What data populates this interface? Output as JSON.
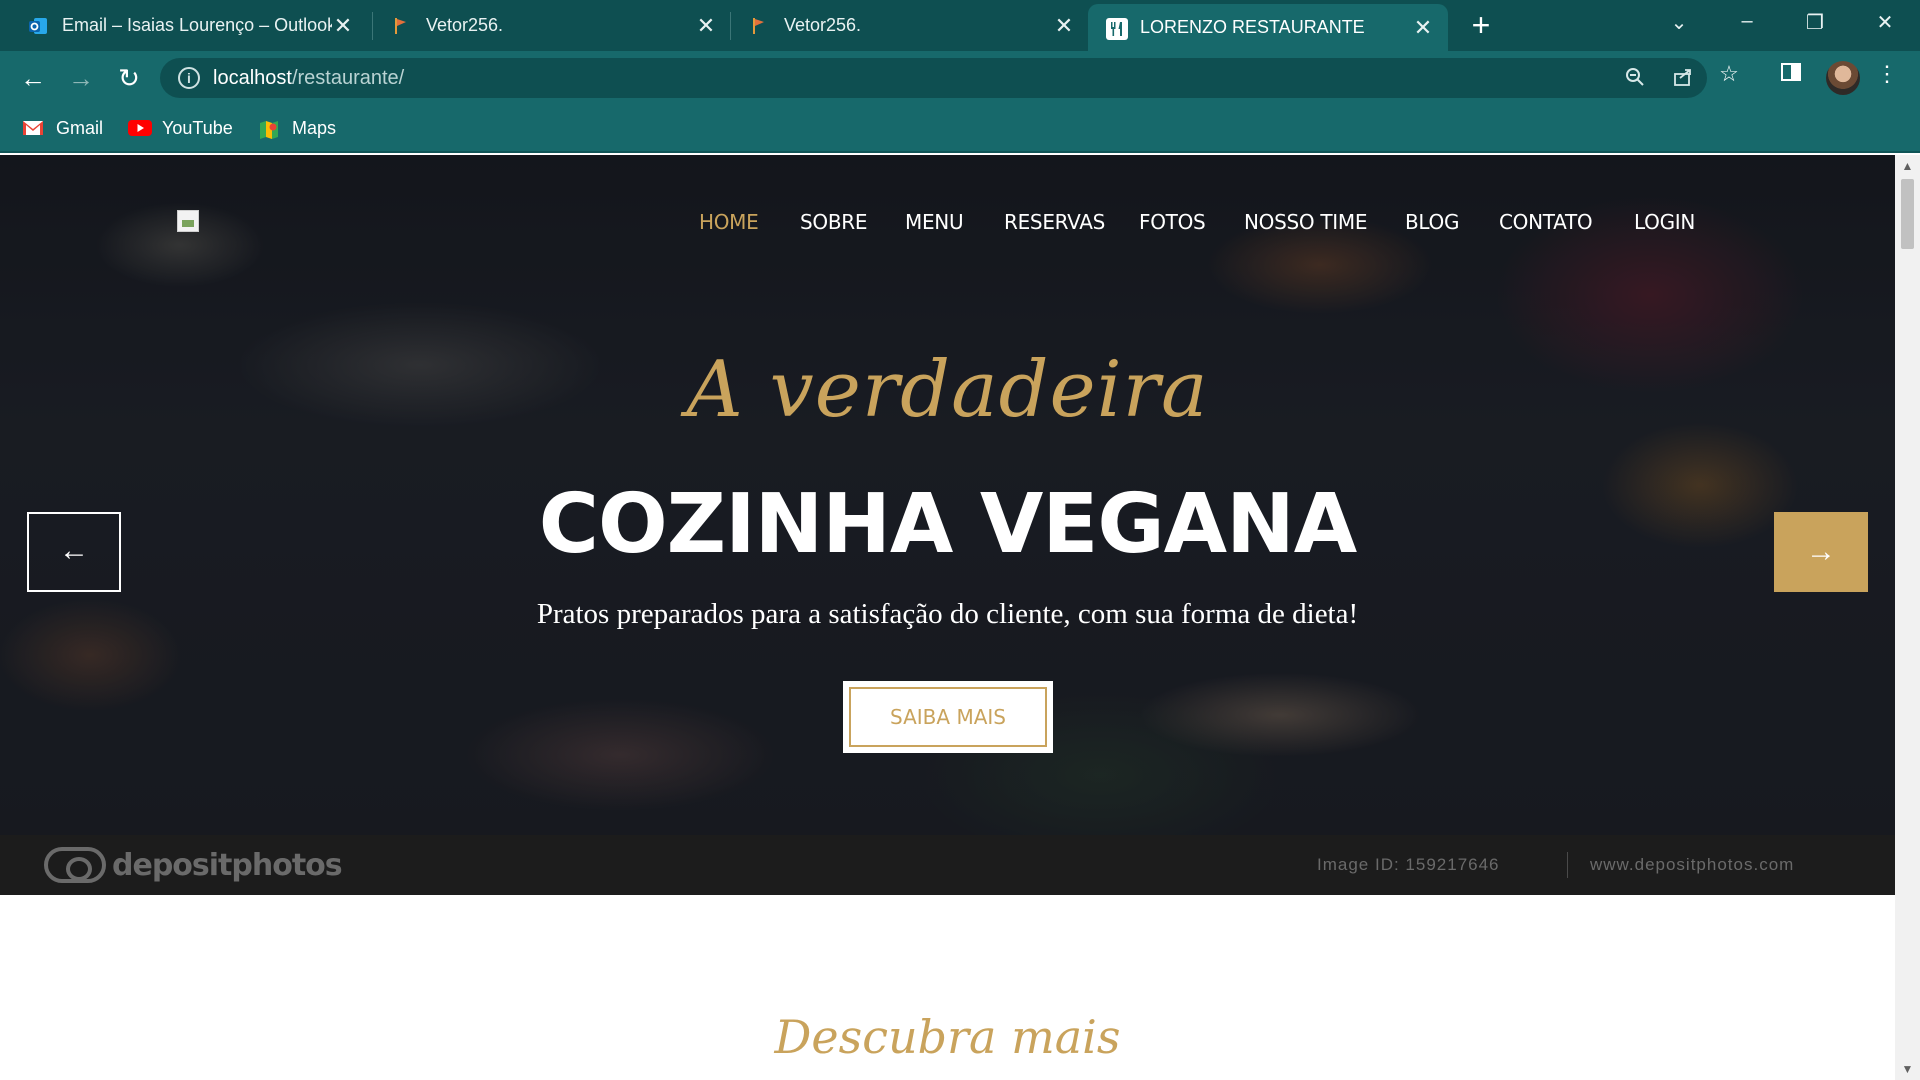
{
  "browser": {
    "tabs": [
      {
        "title": "Email – Isaias Lourenço – Outlook",
        "icon": "outlook-icon",
        "active": false
      },
      {
        "title": "Vetor256.",
        "icon": "flag-icon",
        "active": false
      },
      {
        "title": "Vetor256.",
        "icon": "flag-icon",
        "active": false
      },
      {
        "title": "LORENZO RESTAURANTE",
        "icon": "fork-knife-icon",
        "active": true
      }
    ],
    "new_tab_label": "+",
    "url_host": "localhost",
    "url_path": "/restaurante/",
    "bookmarks": [
      {
        "label": "Gmail",
        "icon": "gmail-icon"
      },
      {
        "label": "YouTube",
        "icon": "youtube-icon"
      },
      {
        "label": "Maps",
        "icon": "maps-icon"
      }
    ],
    "colors": {
      "chrome_dark": "#0e4f51",
      "chrome": "#17696b"
    }
  },
  "site": {
    "nav": [
      {
        "label": "HOME",
        "active": true
      },
      {
        "label": "SOBRE",
        "active": false
      },
      {
        "label": "MENU",
        "active": false
      },
      {
        "label": "RESERVAS",
        "active": false
      },
      {
        "label": "FOTOS",
        "active": false
      },
      {
        "label": "NOSSO TIME",
        "active": false
      },
      {
        "label": "BLOG",
        "active": false
      },
      {
        "label": "CONTATO",
        "active": false
      },
      {
        "label": "LOGIN",
        "active": false
      }
    ],
    "hero": {
      "script_title": "A verdadeira",
      "title": "COZINHA VEGANA",
      "subtitle": "Pratos preparados para a satisfação do cliente, com sua forma de dieta!",
      "cta": "SAIBA MAIS",
      "prev_arrow": "←",
      "next_arrow": "→"
    },
    "watermark": {
      "brand": "depositphotos",
      "image_id": "Image ID: 159217646",
      "url": "www.depositphotos.com"
    },
    "section_heading": "Descubra mais",
    "accent_color": "#c9a35c"
  }
}
